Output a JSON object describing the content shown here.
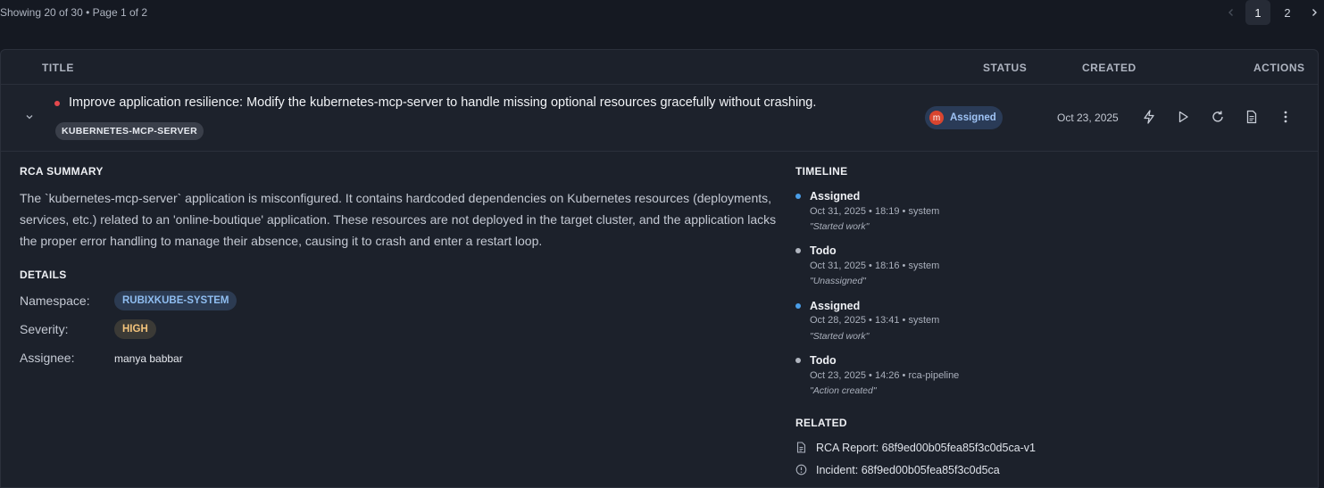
{
  "pagination": {
    "summary": "Showing 20 of 30 • Page 1 of 2",
    "pages": [
      "1",
      "2"
    ],
    "current_page": "1",
    "prev_icon": "chevron-left-icon",
    "next_icon": "chevron-right-icon"
  },
  "table": {
    "columns": {
      "title": "TITLE",
      "status": "STATUS",
      "created": "CREATED",
      "actions": "ACTIONS"
    },
    "row": {
      "priority_color": "#e5484d",
      "title": "Improve application resilience: Modify the kubernetes-mcp-server to handle missing optional resources gracefully without crashing.",
      "service_tag": "KUBERNETES-MCP-SERVER",
      "status": {
        "avatar_initial": "m",
        "label": "Assigned"
      },
      "created": "Oct 23, 2025",
      "action_icons": [
        "lightning-icon",
        "play-icon",
        "refresh-icon",
        "document-icon",
        "more-vertical-icon"
      ]
    }
  },
  "details": {
    "rca_heading": "RCA SUMMARY",
    "rca_text": "The `kubernetes-mcp-server` application is misconfigured. It contains hardcoded dependencies on Kubernetes resources (deployments, services, etc.) related to an 'online-boutique' application. These resources are not deployed in the target cluster, and the application lacks the proper error handling to manage their absence, causing it to crash and enter a restart loop.",
    "details_heading": "DETAILS",
    "namespace_label": "Namespace:",
    "namespace_value": "RUBIXKUBE-SYSTEM",
    "severity_label": "Severity:",
    "severity_value": "HIGH",
    "assignee_label": "Assignee:",
    "assignee_value": "manya babbar"
  },
  "timeline": {
    "heading": "TIMELINE",
    "events": [
      {
        "title": "Assigned",
        "meta": "Oct 31, 2025 • 18:19 • system",
        "note": "\"Started work\"",
        "dot_color": "#4a9ee8"
      },
      {
        "title": "Todo",
        "meta": "Oct 31, 2025 • 18:16 • system",
        "note": "\"Unassigned\"",
        "dot_color": "#b0b5bf"
      },
      {
        "title": "Assigned",
        "meta": "Oct 28, 2025 • 13:41 • system",
        "note": "\"Started work\"",
        "dot_color": "#4a9ee8"
      },
      {
        "title": "Todo",
        "meta": "Oct 23, 2025 • 14:26 • rca-pipeline",
        "note": "\"Action created\"",
        "dot_color": "#b0b5bf"
      }
    ]
  },
  "related": {
    "heading": "RELATED",
    "items": [
      {
        "icon": "document-icon",
        "text": "RCA Report: 68f9ed00b05fea85f3c0d5ca-v1"
      },
      {
        "icon": "alert-circle-icon",
        "text": "Incident: 68f9ed00b05fea85f3c0d5ca"
      }
    ]
  }
}
